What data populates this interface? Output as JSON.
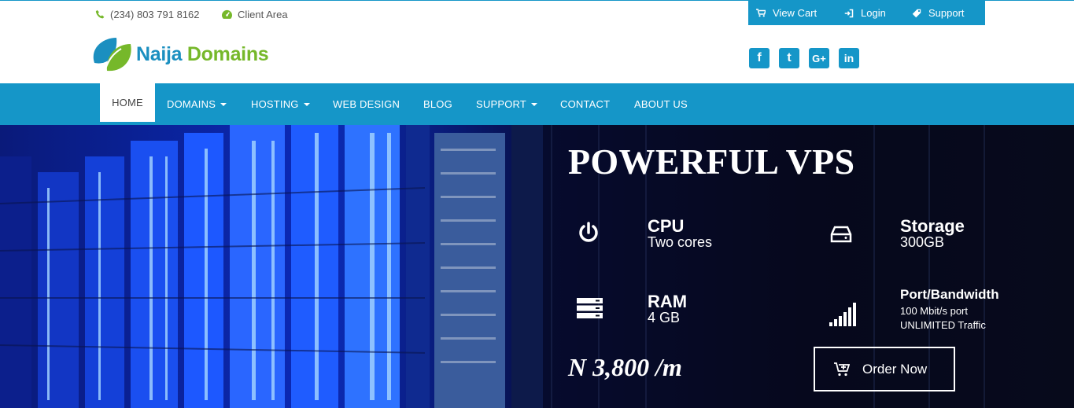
{
  "topbar": {
    "phone": "(234) 803 791 8162",
    "client_area": "Client Area",
    "view_cart": "View Cart",
    "login": "Login",
    "support": "Support"
  },
  "logo": {
    "part1": "Naija",
    "part2": "Domains"
  },
  "social": {
    "facebook": "f",
    "twitter": "t",
    "google": "G+",
    "linkedin": "in"
  },
  "nav": {
    "items": [
      {
        "label": "HOME",
        "active": true
      },
      {
        "label": "DOMAINS",
        "dropdown": true
      },
      {
        "label": "HOSTING",
        "dropdown": true
      },
      {
        "label": "WEB DESIGN"
      },
      {
        "label": "BLOG"
      },
      {
        "label": "SUPPORT",
        "dropdown": true
      },
      {
        "label": "CONTACT"
      },
      {
        "label": "ABOUT US"
      }
    ]
  },
  "hero": {
    "title": "POWERFUL VPS",
    "cpu": {
      "title": "CPU",
      "value": "Two cores"
    },
    "storage": {
      "title": "Storage",
      "value": "300GB"
    },
    "ram": {
      "title": "RAM",
      "value": "4 GB"
    },
    "bandwidth": {
      "title": "Port/Bandwidth",
      "line1": "100 Mbit/s port",
      "line2": "UNLIMITED Traffic"
    },
    "price": "N 3,800 /m",
    "order_label": "Order Now"
  },
  "colors": {
    "brand_blue": "#1596c8",
    "brand_green": "#76b82a"
  }
}
